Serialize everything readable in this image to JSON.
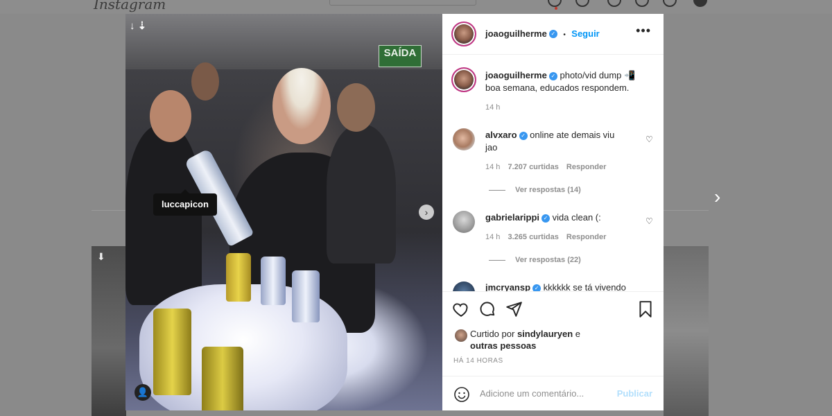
{
  "background": {
    "logo_text": "Instagram"
  },
  "post": {
    "tagged_user": "luccapicon",
    "header": {
      "username": "joaoguilherme",
      "separator": "•",
      "follow_label": "Seguir",
      "more_label": "•••"
    },
    "caption": {
      "username": "joaoguilherme",
      "text_line1": "photo/vid dump 📲",
      "text_line2": "boa semana, educados respondem.",
      "time": "14 h"
    },
    "comments": [
      {
        "username": "alvxaro",
        "text_line1": "online ate demais viu",
        "text_line2": "jao",
        "time": "14 h",
        "likes": "7.207 curtidas",
        "reply_label": "Responder",
        "view_replies": "Ver respostas (14)"
      },
      {
        "username": "gabrielarippi",
        "text_line1": "vida clean (:",
        "time": "14 h",
        "likes": "3.265 curtidas",
        "reply_label": "Responder",
        "view_replies": "Ver respostas (22)"
      },
      {
        "username": "jmcryansp",
        "text_line1": "kkkkkk se tá vivendo"
      }
    ],
    "likes_prefix": "Curtido por",
    "likes_user": "sindylauryen",
    "likes_conj": "e",
    "likes_others": "outras pessoas",
    "time_ago": "HÁ 14 HORAS",
    "comment_placeholder": "Adicione um comentário...",
    "publish_label": "Publicar",
    "media_sign_text": "SAÍDA"
  },
  "colors": {
    "link": "#0095f6",
    "verified": "#3897f0",
    "publish_disabled": "#b2dffc"
  }
}
